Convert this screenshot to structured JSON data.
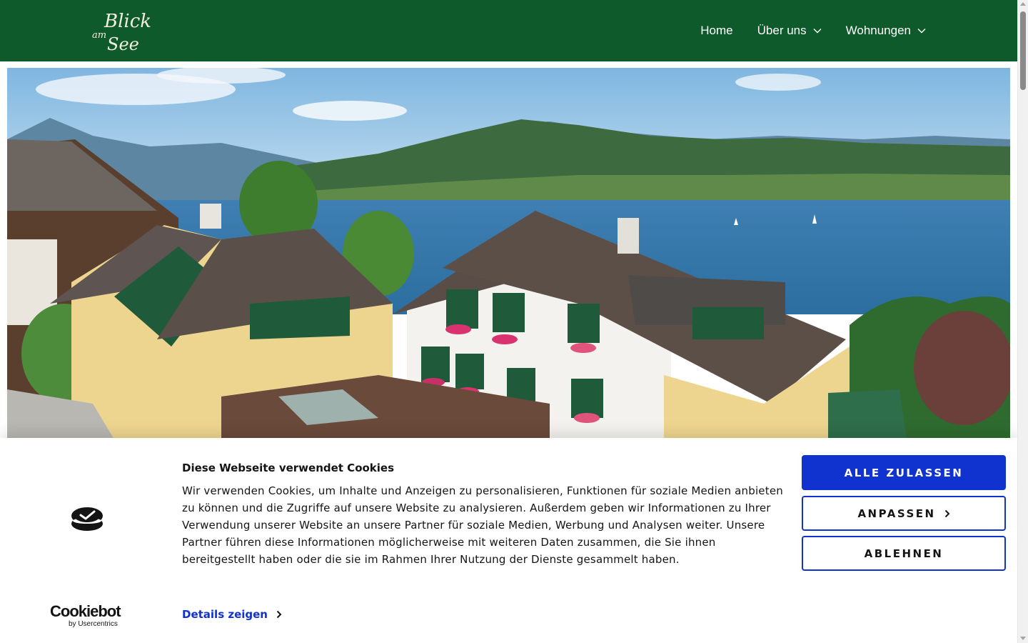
{
  "header": {
    "logo": {
      "line1": "Blick",
      "line2": "am",
      "line3": "See"
    },
    "nav": [
      {
        "label": "Home",
        "has_dropdown": false
      },
      {
        "label": "Über uns",
        "has_dropdown": true
      },
      {
        "label": "Wohnungen",
        "has_dropdown": true
      }
    ]
  },
  "cookie_banner": {
    "title": "Diese Webseite verwendet Cookies",
    "body": "Wir verwenden Cookies, um Inhalte und Anzeigen zu personalisieren, Funktionen für soziale Medien anbieten zu können und die Zugriffe auf unsere Website zu analysieren. Außerdem geben wir Informationen zu Ihrer Verwendung unserer Website an unsere Partner für soziale Medien, Werbung und Analysen weiter. Unsere Partner führen diese Informationen möglicherweise mit weiteren Daten zusammen, die Sie ihnen bereitgestellt haben oder die sie im Rahmen Ihrer Nutzung der Dienste gesammelt haben.",
    "details_link": "Details zeigen",
    "buttons": {
      "allow_all": "ALLE ZULASSEN",
      "customize": "ANPASSEN",
      "deny": "ABLEHNEN"
    },
    "brand": {
      "name": "Cookiebot",
      "sub": "by Usercentrics"
    }
  },
  "colors": {
    "header_bg": "#0e5a2b",
    "accent_blue": "#1032cf"
  }
}
